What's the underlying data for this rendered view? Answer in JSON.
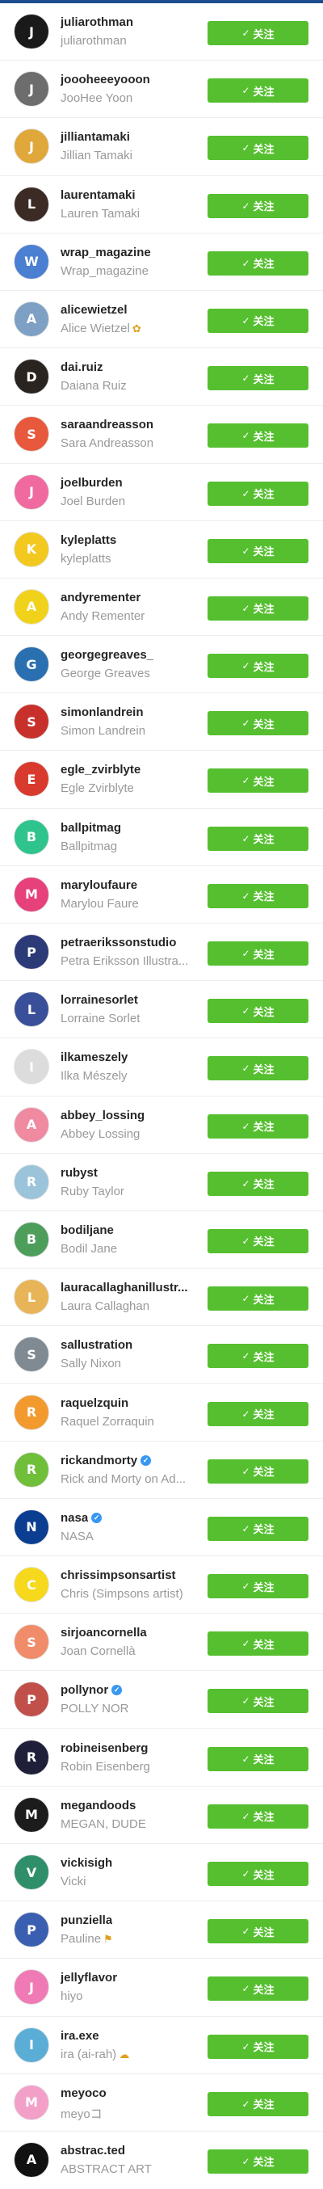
{
  "follow_label": "关注",
  "check_glyph": "✓",
  "verified_glyph": "✓",
  "users": [
    {
      "username": "juliarothman",
      "fullname": "juliarothman",
      "avatar_bg": "#1a1a1a",
      "initial": "J"
    },
    {
      "username": "joooheeeyooon",
      "fullname": "JooHee Yoon",
      "avatar_bg": "#6d6d6d",
      "initial": "J"
    },
    {
      "username": "jilliantamaki",
      "fullname": "Jillian Tamaki",
      "avatar_bg": "#e0a83a",
      "initial": "J"
    },
    {
      "username": "laurentamaki",
      "fullname": "Lauren Tamaki",
      "avatar_bg": "#3b2b24",
      "initial": "L"
    },
    {
      "username": "wrap_magazine",
      "fullname": "Wrap_magazine",
      "avatar_bg": "#4a7fd1",
      "initial": "W"
    },
    {
      "username": "alicewietzel",
      "fullname": "Alice Wietzel",
      "fullname_emoji": "✿",
      "avatar_bg": "#7ea0c4",
      "initial": "A"
    },
    {
      "username": "dai.ruiz",
      "fullname": "Daiana Ruiz",
      "avatar_bg": "#2a2420",
      "initial": "D"
    },
    {
      "username": "saraandreasson",
      "fullname": "Sara Andreasson",
      "avatar_bg": "#e8583c",
      "initial": "S"
    },
    {
      "username": "joelburden",
      "fullname": "Joel Burden",
      "avatar_bg": "#f06aa0",
      "initial": "J"
    },
    {
      "username": "kyleplatts",
      "fullname": "kyleplatts",
      "avatar_bg": "#f3c81f",
      "initial": "K"
    },
    {
      "username": "andyrementer",
      "fullname": "Andy Rementer",
      "avatar_bg": "#f1d21a",
      "initial": "A"
    },
    {
      "username": "georgegreaves_",
      "fullname": "George Greaves",
      "avatar_bg": "#2a6fb0",
      "initial": "G"
    },
    {
      "username": "simonlandrein",
      "fullname": "Simon Landrein",
      "avatar_bg": "#c8312b",
      "initial": "S"
    },
    {
      "username": "egle_zvirblyte",
      "fullname": "Egle Zvirblyte",
      "avatar_bg": "#d83a2e",
      "initial": "E"
    },
    {
      "username": "ballpitmag",
      "fullname": "Ballpitmag",
      "avatar_bg": "#2fc48d",
      "initial": "B"
    },
    {
      "username": "maryloufaure",
      "fullname": "Marylou Faure",
      "avatar_bg": "#e6417a",
      "initial": "M"
    },
    {
      "username": "petraerikssonstudio",
      "fullname": "Petra Eriksson Illustra...",
      "avatar_bg": "#2c3a78",
      "initial": "P"
    },
    {
      "username": "lorrainesorlet",
      "fullname": "Lorraine Sorlet",
      "avatar_bg": "#3a4f9a",
      "initial": "L"
    },
    {
      "username": "ilkameszely",
      "fullname": "Ilka Mészely",
      "avatar_bg": "#dcdcdc",
      "initial": "I"
    },
    {
      "username": "abbey_lossing",
      "fullname": "Abbey Lossing",
      "avatar_bg": "#ef8aa0",
      "initial": "A"
    },
    {
      "username": "rubyst",
      "fullname": "Ruby Taylor",
      "avatar_bg": "#9bc3d9",
      "initial": "R"
    },
    {
      "username": "bodiljane",
      "fullname": "Bodil Jane",
      "avatar_bg": "#4e9e5b",
      "initial": "B"
    },
    {
      "username": "lauracallaghanillustr...",
      "fullname": "Laura Callaghan",
      "avatar_bg": "#e7b457",
      "initial": "L"
    },
    {
      "username": "sallustration",
      "fullname": "Sally Nixon",
      "avatar_bg": "#7f8a92",
      "initial": "S"
    },
    {
      "username": "raquelzquin",
      "fullname": "Raquel Zorraquin",
      "avatar_bg": "#f29a2e",
      "initial": "R"
    },
    {
      "username": "rickandmorty",
      "fullname": "Rick and Morty on Ad...",
      "verified": true,
      "avatar_bg": "#6fbf3a",
      "initial": "R"
    },
    {
      "username": "nasa",
      "fullname": "NASA",
      "verified": true,
      "avatar_bg": "#0b3d91",
      "initial": "N"
    },
    {
      "username": "chrissimpsonsartist",
      "fullname": "Chris (Simpsons artist)",
      "avatar_bg": "#f6d81c",
      "initial": "C"
    },
    {
      "username": "sirjoancornella",
      "fullname": "Joan Cornellà",
      "avatar_bg": "#f08c6a",
      "initial": "S"
    },
    {
      "username": "pollynor",
      "fullname": "POLLY NOR",
      "verified": true,
      "avatar_bg": "#c1504a",
      "initial": "P"
    },
    {
      "username": "robineisenberg",
      "fullname": "Robin Eisenberg",
      "avatar_bg": "#1f1f3a",
      "initial": "R"
    },
    {
      "username": "megandoods",
      "fullname": "MEGAN, DUDE",
      "avatar_bg": "#1c1c1c",
      "initial": "M"
    },
    {
      "username": "vickisigh",
      "fullname": "Vicki",
      "avatar_bg": "#2f8f6b",
      "initial": "V"
    },
    {
      "username": "punziella",
      "fullname": "Pauline",
      "fullname_emoji": "⚑",
      "avatar_bg": "#3b5fb0",
      "initial": "P"
    },
    {
      "username": "jellyflavor",
      "fullname": "hiyo",
      "avatar_bg": "#f07ab5",
      "initial": "J"
    },
    {
      "username": "ira.exe",
      "fullname": "ira (ai-rah)",
      "fullname_emoji": "☁",
      "avatar_bg": "#5aaed6",
      "initial": "I"
    },
    {
      "username": "meyoco",
      "fullname": "meyoコ",
      "avatar_bg": "#f3a0c8",
      "initial": "M"
    },
    {
      "username": "abstrac.ted",
      "fullname": "ABSTRACT ART",
      "avatar_bg": "#111111",
      "initial": "A"
    }
  ]
}
